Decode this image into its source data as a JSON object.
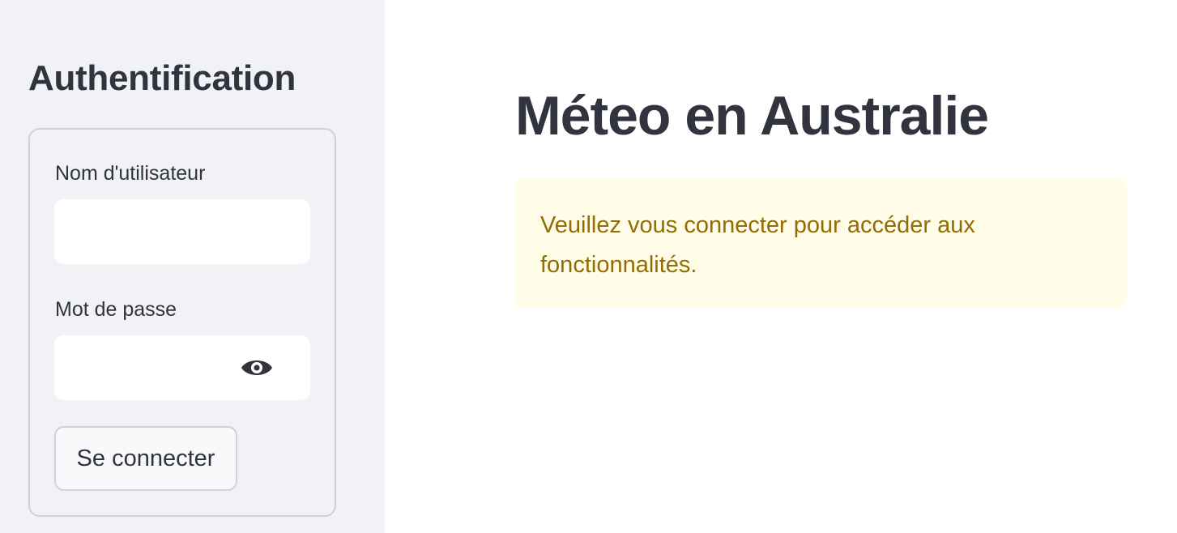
{
  "sidebar": {
    "title": "Authentification",
    "form": {
      "username_label": "Nom d'utilisateur",
      "username_value": "",
      "password_label": "Mot de passe",
      "password_value": "",
      "show_password_icon": "eye-icon",
      "submit_label": "Se connecter"
    }
  },
  "main": {
    "title": "Méteo en Australie",
    "warning": "Veuillez vous connecter pour accéder aux fonctionnalités."
  },
  "colors": {
    "sidebar_background": "#f0f2f6",
    "text": "#31333f",
    "warning_background": "#fffce7",
    "warning_text": "#926c05"
  }
}
